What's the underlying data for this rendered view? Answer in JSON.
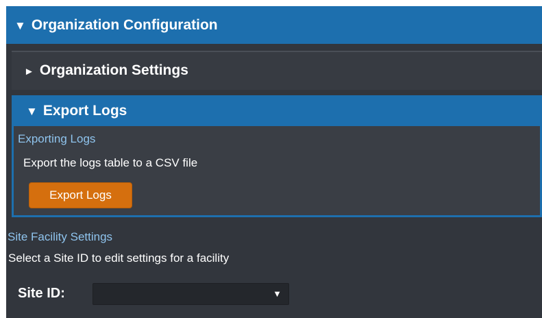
{
  "org_config": {
    "title": "Organization Configuration",
    "expand_glyph": "▼"
  },
  "org_settings": {
    "title": "Organization Settings",
    "expand_glyph": "►"
  },
  "export_logs": {
    "title": "Export Logs",
    "expand_glyph": "▼",
    "subheading": "Exporting Logs",
    "description": "Export the logs table to a CSV file",
    "button_label": "Export Logs"
  },
  "site_facility": {
    "subheading": "Site Facility Settings",
    "description": "Select a Site ID to edit settings for a facility",
    "site_id_label": "Site ID:",
    "site_id_value": "",
    "dropdown_glyph": "▼"
  },
  "colors": {
    "accent_blue": "#1d6fae",
    "panel_bg": "#32363d",
    "subheading_text": "#8fc4ee",
    "export_button": "#d56f0e"
  }
}
